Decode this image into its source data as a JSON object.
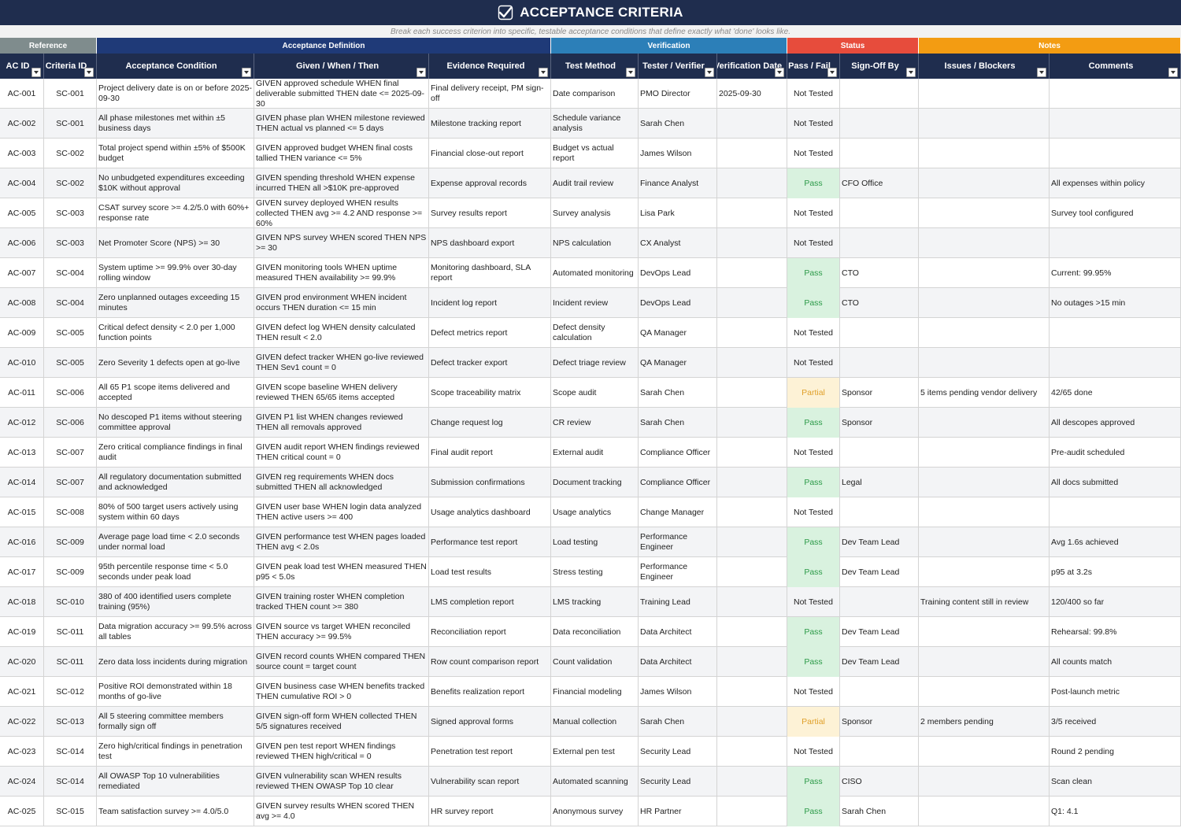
{
  "title": "ACCEPTANCE CRITERIA",
  "subtitle": "Break each success criterion into specific, testable acceptance conditions that define exactly what 'done' looks like.",
  "groups": [
    {
      "label": "Reference",
      "color": "#7f8c8d"
    },
    {
      "label": "Acceptance Definition",
      "color": "#1f3a78"
    },
    {
      "label": "Verification",
      "color": "#2c7fb8"
    },
    {
      "label": "Status",
      "color": "#e74c3c"
    },
    {
      "label": "Notes",
      "color": "#f39c12"
    }
  ],
  "columns": [
    "AC ID",
    "Criteria ID",
    "Acceptance Condition",
    "Given / When / Then",
    "Evidence Required",
    "Test Method",
    "Tester / Verifier",
    "Verification Date",
    "Pass / Fail",
    "Sign-Off By",
    "Issues / Blockers",
    "Comments"
  ],
  "colors": {
    "pass_bg": "#d9f2df",
    "pass_text": "#2c9a48",
    "partial_bg": "#fdf2d6",
    "partial_text": "#e0a02a",
    "header_bg": "#1f2d4e"
  },
  "rows": [
    [
      "AC-001",
      "SC-001",
      "Project delivery date is on or before 2025-09-30",
      "GIVEN approved schedule WHEN final deliverable submitted THEN date <= 2025-09-30",
      "Final delivery receipt, PM sign-off",
      "Date comparison",
      "PMO Director",
      "2025-09-30",
      "Not Tested",
      "",
      "",
      ""
    ],
    [
      "AC-002",
      "SC-001",
      "All phase milestones met within ±5 business days",
      "GIVEN phase plan WHEN milestone reviewed THEN actual vs planned <= 5 days",
      "Milestone tracking report",
      "Schedule variance analysis",
      "Sarah Chen",
      "",
      "Not Tested",
      "",
      "",
      ""
    ],
    [
      "AC-003",
      "SC-002",
      "Total project spend within ±5% of $500K budget",
      "GIVEN approved budget WHEN final costs tallied THEN variance <= 5%",
      "Financial close-out report",
      "Budget vs actual report",
      "James Wilson",
      "",
      "Not Tested",
      "",
      "",
      ""
    ],
    [
      "AC-004",
      "SC-002",
      "No unbudgeted expenditures exceeding $10K without approval",
      "GIVEN spending threshold WHEN expense incurred THEN all >$10K pre-approved",
      "Expense approval records",
      "Audit trail review",
      "Finance Analyst",
      "",
      "Pass",
      "CFO Office",
      "",
      "All expenses within policy"
    ],
    [
      "AC-005",
      "SC-003",
      "CSAT survey score >= 4.2/5.0 with 60%+ response rate",
      "GIVEN survey deployed WHEN results collected THEN avg >= 4.2 AND response >= 60%",
      "Survey results report",
      "Survey analysis",
      "Lisa Park",
      "",
      "Not Tested",
      "",
      "",
      "Survey tool configured"
    ],
    [
      "AC-006",
      "SC-003",
      "Net Promoter Score (NPS) >= 30",
      "GIVEN NPS survey WHEN scored THEN NPS >= 30",
      "NPS dashboard export",
      "NPS calculation",
      "CX Analyst",
      "",
      "Not Tested",
      "",
      "",
      ""
    ],
    [
      "AC-007",
      "SC-004",
      "System uptime >= 99.9% over 30-day rolling window",
      "GIVEN monitoring tools WHEN uptime measured THEN availability >= 99.9%",
      "Monitoring dashboard, SLA report",
      "Automated monitoring",
      "DevOps Lead",
      "",
      "Pass",
      "CTO",
      "",
      "Current: 99.95%"
    ],
    [
      "AC-008",
      "SC-004",
      "Zero unplanned outages exceeding 15 minutes",
      "GIVEN prod environment WHEN incident occurs THEN duration <= 15 min",
      "Incident log report",
      "Incident review",
      "DevOps Lead",
      "",
      "Pass",
      "CTO",
      "",
      "No outages >15 min"
    ],
    [
      "AC-009",
      "SC-005",
      "Critical defect density < 2.0 per 1,000 function points",
      "GIVEN defect log WHEN density calculated THEN result < 2.0",
      "Defect metrics report",
      "Defect density calculation",
      "QA Manager",
      "",
      "Not Tested",
      "",
      "",
      ""
    ],
    [
      "AC-010",
      "SC-005",
      "Zero Severity 1 defects open at go-live",
      "GIVEN defect tracker WHEN go-live reviewed THEN Sev1 count = 0",
      "Defect tracker export",
      "Defect triage review",
      "QA Manager",
      "",
      "Not Tested",
      "",
      "",
      ""
    ],
    [
      "AC-011",
      "SC-006",
      "All 65 P1 scope items delivered and accepted",
      "GIVEN scope baseline WHEN delivery reviewed THEN 65/65 items accepted",
      "Scope traceability matrix",
      "Scope audit",
      "Sarah Chen",
      "",
      "Partial",
      "Sponsor",
      "5 items pending vendor delivery",
      "42/65 done"
    ],
    [
      "AC-012",
      "SC-006",
      "No descoped P1 items without steering committee approval",
      "GIVEN P1 list WHEN changes reviewed THEN all removals approved",
      "Change request log",
      "CR review",
      "Sarah Chen",
      "",
      "Pass",
      "Sponsor",
      "",
      "All descopes approved"
    ],
    [
      "AC-013",
      "SC-007",
      "Zero critical compliance findings in final audit",
      "GIVEN audit report WHEN findings reviewed THEN critical count = 0",
      "Final audit report",
      "External audit",
      "Compliance Officer",
      "",
      "Not Tested",
      "",
      "",
      "Pre-audit scheduled"
    ],
    [
      "AC-014",
      "SC-007",
      "All regulatory documentation submitted and acknowledged",
      "GIVEN reg requirements WHEN docs submitted THEN all acknowledged",
      "Submission confirmations",
      "Document tracking",
      "Compliance Officer",
      "",
      "Pass",
      "Legal",
      "",
      "All docs submitted"
    ],
    [
      "AC-015",
      "SC-008",
      "80% of 500 target users actively using system within 60 days",
      "GIVEN user base WHEN login data analyzed THEN active users >= 400",
      "Usage analytics dashboard",
      "Usage analytics",
      "Change Manager",
      "",
      "Not Tested",
      "",
      "",
      ""
    ],
    [
      "AC-016",
      "SC-009",
      "Average page load time < 2.0 seconds under normal load",
      "GIVEN performance test WHEN pages loaded THEN avg < 2.0s",
      "Performance test report",
      "Load testing",
      "Performance Engineer",
      "",
      "Pass",
      "Dev Team Lead",
      "",
      "Avg 1.6s achieved"
    ],
    [
      "AC-017",
      "SC-009",
      "95th percentile response time < 5.0 seconds under peak load",
      "GIVEN peak load test WHEN measured THEN p95 < 5.0s",
      "Load test results",
      "Stress testing",
      "Performance Engineer",
      "",
      "Pass",
      "Dev Team Lead",
      "",
      "p95 at 3.2s"
    ],
    [
      "AC-018",
      "SC-010",
      "380 of 400 identified users complete training (95%)",
      "GIVEN training roster WHEN completion tracked THEN count >= 380",
      "LMS completion report",
      "LMS tracking",
      "Training Lead",
      "",
      "Not Tested",
      "",
      "Training content still in review",
      "120/400 so far"
    ],
    [
      "AC-019",
      "SC-011",
      "Data migration accuracy >= 99.5% across all tables",
      "GIVEN source vs target WHEN reconciled THEN accuracy >= 99.5%",
      "Reconciliation report",
      "Data reconciliation",
      "Data Architect",
      "",
      "Pass",
      "Dev Team Lead",
      "",
      "Rehearsal: 99.8%"
    ],
    [
      "AC-020",
      "SC-011",
      "Zero data loss incidents during migration",
      "GIVEN record counts WHEN compared THEN source count = target count",
      "Row count comparison report",
      "Count validation",
      "Data Architect",
      "",
      "Pass",
      "Dev Team Lead",
      "",
      "All counts match"
    ],
    [
      "AC-021",
      "SC-012",
      "Positive ROI demonstrated within 18 months of go-live",
      "GIVEN business case WHEN benefits tracked THEN cumulative ROI > 0",
      "Benefits realization report",
      "Financial modeling",
      "James Wilson",
      "",
      "Not Tested",
      "",
      "",
      "Post-launch metric"
    ],
    [
      "AC-022",
      "SC-013",
      "All 5 steering committee members formally sign off",
      "GIVEN sign-off form WHEN collected THEN 5/5 signatures received",
      "Signed approval forms",
      "Manual collection",
      "Sarah Chen",
      "",
      "Partial",
      "Sponsor",
      "2 members pending",
      "3/5 received"
    ],
    [
      "AC-023",
      "SC-014",
      "Zero high/critical findings in penetration test",
      "GIVEN pen test report WHEN findings reviewed THEN high/critical = 0",
      "Penetration test report",
      "External pen test",
      "Security Lead",
      "",
      "Not Tested",
      "",
      "",
      "Round 2 pending"
    ],
    [
      "AC-024",
      "SC-014",
      "All OWASP Top 10 vulnerabilities remediated",
      "GIVEN vulnerability scan WHEN results reviewed THEN OWASP Top 10 clear",
      "Vulnerability scan report",
      "Automated scanning",
      "Security Lead",
      "",
      "Pass",
      "CISO",
      "",
      "Scan clean"
    ],
    [
      "AC-025",
      "SC-015",
      "Team satisfaction survey >= 4.0/5.0",
      "GIVEN survey results WHEN scored THEN avg >= 4.0",
      "HR survey report",
      "Anonymous survey",
      "HR Partner",
      "",
      "Pass",
      "Sarah Chen",
      "",
      "Q1: 4.1"
    ]
  ]
}
